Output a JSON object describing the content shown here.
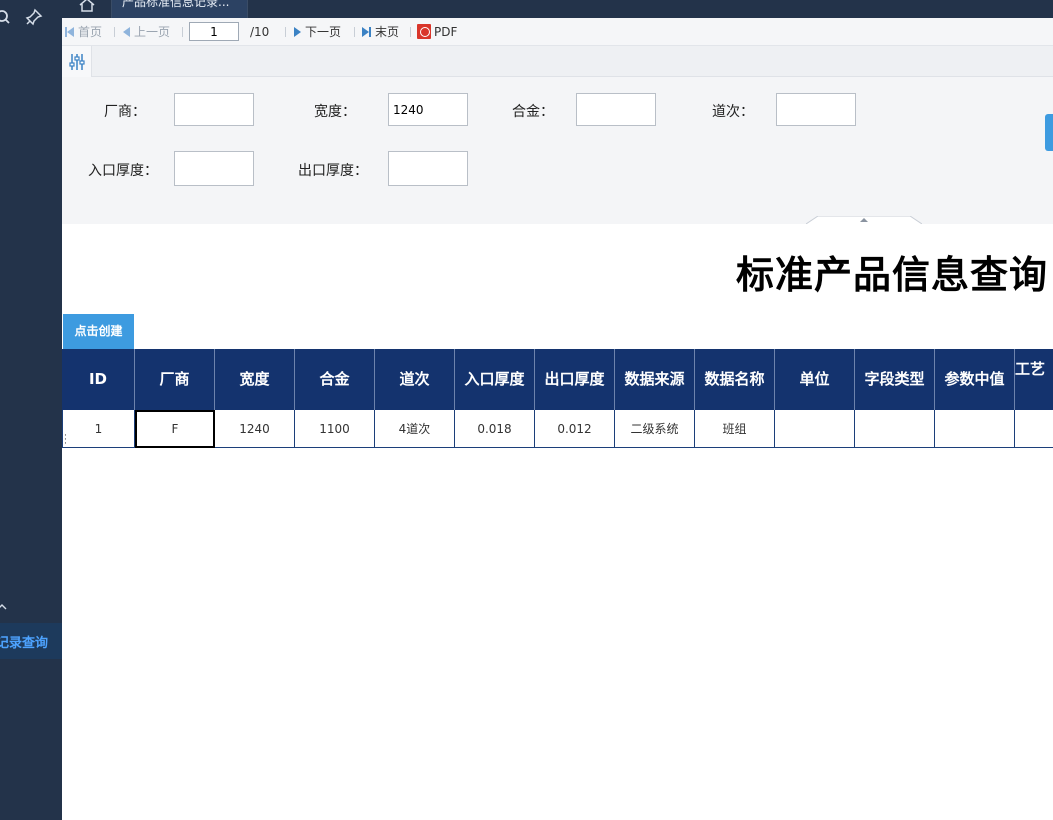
{
  "sidebar": {
    "active_item_label": "记录查询"
  },
  "tabs": {
    "active_tab_label": "产品标准信息记录..."
  },
  "toolbar": {
    "first_label": "首页",
    "prev_label": "上一页",
    "current_page": "1",
    "total_pages": "/10",
    "next_label": "下一页",
    "last_label": "末页",
    "pdf_label": "PDF"
  },
  "form": {
    "vendor_label": "厂商：",
    "vendor_value": "",
    "width_label": "宽度：",
    "width_value": "1240",
    "alloy_label": "合金：",
    "alloy_value": "",
    "pass_label": "道次：",
    "pass_value": "",
    "entry_thickness_label": "入口厚度：",
    "entry_thickness_value": "",
    "exit_thickness_label": "出口厚度：",
    "exit_thickness_value": ""
  },
  "report": {
    "title": "标准产品信息查询",
    "create_button": "点击创建"
  },
  "table": {
    "headers": [
      "ID",
      "厂商",
      "宽度",
      "合金",
      "道次",
      "入口厚度",
      "出口厚度",
      "数据来源",
      "数据名称",
      "单位",
      "字段类型",
      "参数中值",
      "工艺（上"
    ],
    "rows": [
      [
        "1",
        "F",
        "1240",
        "1100",
        "4道次",
        "0.018",
        "0.012",
        "二级系统",
        "班组",
        "",
        "",
        "",
        ""
      ]
    ]
  },
  "colors": {
    "sidebar_bg": "#23334a",
    "header_bg": "#14336e",
    "accent_blue": "#3d9be0",
    "pdf_red": "#d9362b"
  }
}
